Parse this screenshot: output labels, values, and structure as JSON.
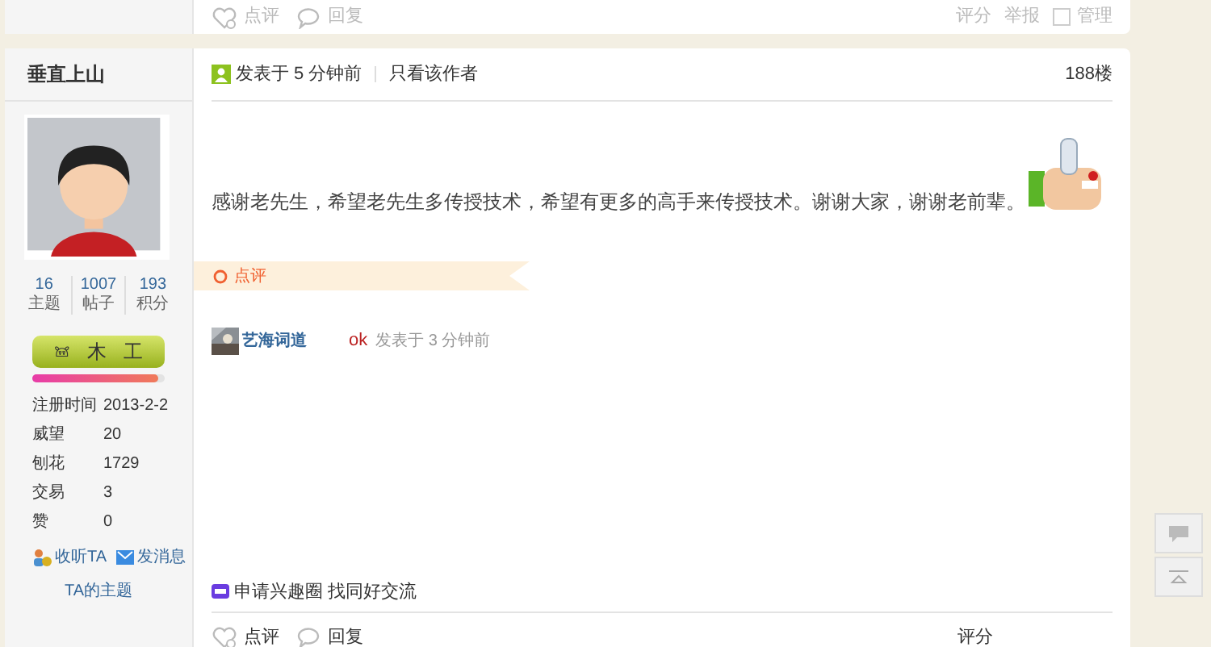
{
  "previous_post": {
    "footer_left": [
      {
        "kind": "rate",
        "label": "点评"
      },
      {
        "kind": "reply",
        "label": "回复"
      }
    ],
    "footer_right": [
      {
        "kind": "text",
        "label": "评分"
      },
      {
        "kind": "text",
        "label": "举报"
      },
      {
        "kind": "checkbox",
        "label": "管理",
        "checked": false
      }
    ]
  },
  "post": {
    "author": {
      "name": "垂直上山",
      "stats": [
        {
          "value": "16",
          "label": "主题"
        },
        {
          "value": "1007",
          "label": "帖子"
        },
        {
          "value": "193",
          "label": "积分"
        }
      ],
      "rank": {
        "icon": "𖠌",
        "chars": [
          "木",
          "工"
        ]
      },
      "level": 0.95,
      "info": [
        {
          "label": "注册时间",
          "value": "2013-2-2"
        },
        {
          "label": "威望",
          "value": "20"
        },
        {
          "label": "刨花",
          "value": "1729"
        },
        {
          "label": "交易",
          "value": "3"
        },
        {
          "label": "赞",
          "value": "0"
        }
      ],
      "links": [
        {
          "kind": "follow",
          "label": "收听TA"
        },
        {
          "kind": "message",
          "label": "发消息"
        }
      ],
      "topics_link": "TA的主题"
    },
    "header": {
      "posted": "发表于 5 分钟前",
      "only_author": "只看该作者",
      "floor": "188楼"
    },
    "body": "感谢老先生，希望老先生多传授技术，希望有更多的高手来传授技术。谢谢大家，谢谢老前辈。",
    "comments_banner": "点评",
    "comments": [
      {
        "user": "艺海词道",
        "text": "ok",
        "time": "发表于 3 分钟前"
      }
    ],
    "interest_link": "申请兴趣圈 找同好交流",
    "footer_left": [
      {
        "kind": "rate",
        "label": "点评"
      },
      {
        "kind": "reply",
        "label": "回复"
      }
    ],
    "footer_right": [
      {
        "kind": "text",
        "label": "评分"
      }
    ]
  }
}
